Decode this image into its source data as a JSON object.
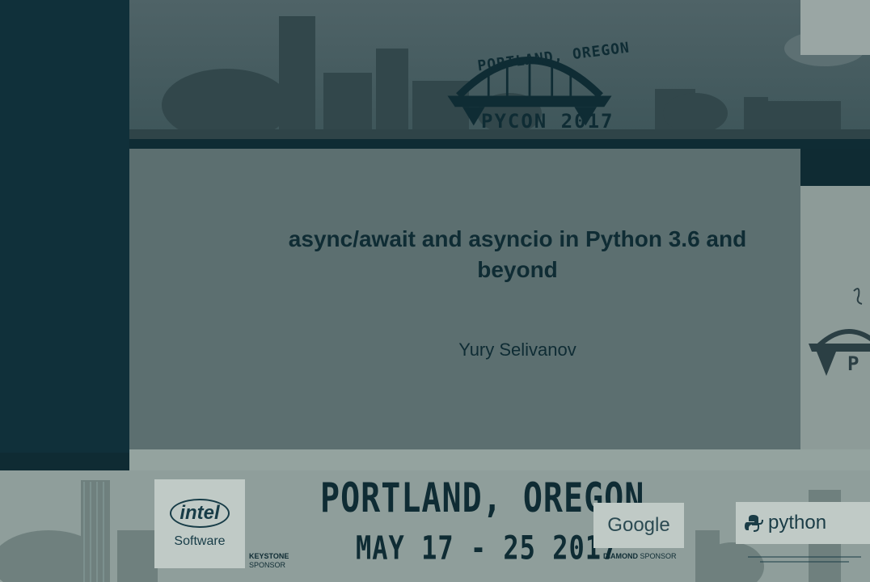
{
  "banner": {
    "logo_top_text": "PORTLAND, OREGON",
    "logo_bottom_text": "PYCON 2017"
  },
  "slide": {
    "title_line1": "async/await and asyncio in Python 3.6 and",
    "title_line2": "beyond",
    "author": "Yury Selivanov"
  },
  "footer": {
    "location": "PORTLAND, OREGON",
    "dates": "MAY 17 - 25 2017",
    "sponsors": [
      {
        "name": "intel",
        "sub": "Software",
        "tier": "KEYSTONE",
        "tier_suffix": "SPONSOR"
      },
      {
        "name": "Google",
        "tier": "DIAMOND",
        "tier_suffix": "SPONSOR"
      },
      {
        "name": "python"
      }
    ]
  },
  "colors": {
    "dark_teal": "#0f2c34",
    "slide_bg": "#5c6f70",
    "band_bg": "#8f9e9b"
  }
}
